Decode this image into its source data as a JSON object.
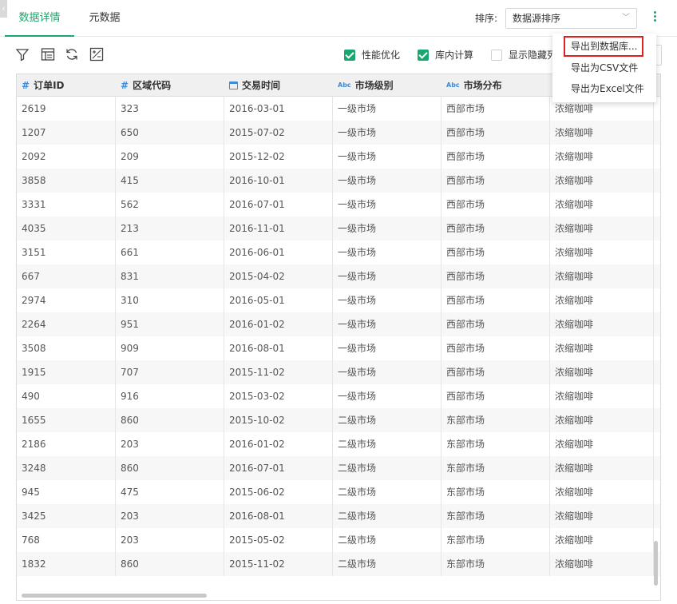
{
  "tabs": [
    {
      "label": "数据详情",
      "active": true
    },
    {
      "label": "元数据",
      "active": false
    }
  ],
  "sort": {
    "label": "排序:",
    "selected": "数据源排序"
  },
  "toolbar": {
    "options": [
      {
        "label": "性能优化",
        "checked": true
      },
      {
        "label": "库内计算",
        "checked": true
      },
      {
        "label": "显示隐藏列",
        "checked": false
      }
    ]
  },
  "menu": {
    "items": [
      {
        "label": "导出到数据库..."
      },
      {
        "label": "导出为CSV文件"
      },
      {
        "label": "导出为Excel文件"
      }
    ]
  },
  "columns": [
    {
      "label": "订单ID",
      "type": "number"
    },
    {
      "label": "区域代码",
      "type": "number"
    },
    {
      "label": "交易时间",
      "type": "date"
    },
    {
      "label": "市场级别",
      "type": "text"
    },
    {
      "label": "市场分布",
      "type": "text"
    },
    {
      "label": "",
      "type": "text"
    }
  ],
  "rows": [
    [
      "2619",
      "323",
      "2016-03-01",
      "一级市场",
      "西部市场",
      "浓缩咖啡"
    ],
    [
      "1207",
      "650",
      "2015-07-02",
      "一级市场",
      "西部市场",
      "浓缩咖啡"
    ],
    [
      "2092",
      "209",
      "2015-12-02",
      "一级市场",
      "西部市场",
      "浓缩咖啡"
    ],
    [
      "3858",
      "415",
      "2016-10-01",
      "一级市场",
      "西部市场",
      "浓缩咖啡"
    ],
    [
      "3331",
      "562",
      "2016-07-01",
      "一级市场",
      "西部市场",
      "浓缩咖啡"
    ],
    [
      "4035",
      "213",
      "2016-11-01",
      "一级市场",
      "西部市场",
      "浓缩咖啡"
    ],
    [
      "3151",
      "661",
      "2016-06-01",
      "一级市场",
      "西部市场",
      "浓缩咖啡"
    ],
    [
      "667",
      "831",
      "2015-04-02",
      "一级市场",
      "西部市场",
      "浓缩咖啡"
    ],
    [
      "2974",
      "310",
      "2016-05-01",
      "一级市场",
      "西部市场",
      "浓缩咖啡"
    ],
    [
      "2264",
      "951",
      "2016-01-02",
      "一级市场",
      "西部市场",
      "浓缩咖啡"
    ],
    [
      "3508",
      "909",
      "2016-08-01",
      "一级市场",
      "西部市场",
      "浓缩咖啡"
    ],
    [
      "1915",
      "707",
      "2015-11-02",
      "一级市场",
      "西部市场",
      "浓缩咖啡"
    ],
    [
      "490",
      "916",
      "2015-03-02",
      "一级市场",
      "西部市场",
      "浓缩咖啡"
    ],
    [
      "1655",
      "860",
      "2015-10-02",
      "二级市场",
      "东部市场",
      "浓缩咖啡"
    ],
    [
      "2186",
      "203",
      "2016-01-02",
      "二级市场",
      "东部市场",
      "浓缩咖啡"
    ],
    [
      "3248",
      "860",
      "2016-07-01",
      "二级市场",
      "东部市场",
      "浓缩咖啡"
    ],
    [
      "945",
      "475",
      "2015-06-02",
      "二级市场",
      "东部市场",
      "浓缩咖啡"
    ],
    [
      "3425",
      "203",
      "2016-08-01",
      "二级市场",
      "东部市场",
      "浓缩咖啡"
    ],
    [
      "768",
      "203",
      "2015-05-02",
      "二级市场",
      "东部市场",
      "浓缩咖啡"
    ],
    [
      "1832",
      "860",
      "2015-11-02",
      "二级市场",
      "东部市场",
      "浓缩咖啡"
    ]
  ],
  "colors": {
    "accent": "#1ca66f",
    "highlight": "#e02020",
    "header_icon": "#3d8bd9"
  }
}
